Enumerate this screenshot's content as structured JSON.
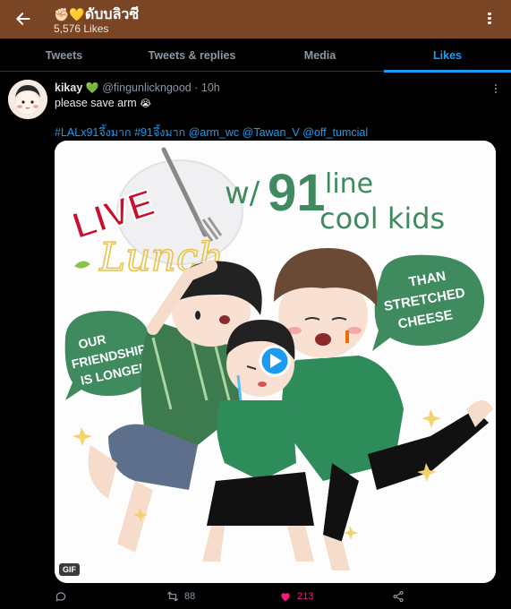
{
  "header": {
    "title_emoji": "✊🏻💛",
    "title": "ดับบลิวซี",
    "subtitle": "5,576 Likes"
  },
  "tabs": [
    {
      "label": "Tweets",
      "active": false
    },
    {
      "label": "Tweets & replies",
      "active": false
    },
    {
      "label": "Media",
      "active": false
    },
    {
      "label": "Likes",
      "active": true
    }
  ],
  "tweet": {
    "display_name": "kikay",
    "name_emoji": "💚",
    "handle": "@fingunlickngood",
    "time": "· 10h",
    "text": "please save arm",
    "text_emoji": "😭",
    "hashtags": [
      "#LALx91จึ้งมาก",
      "#91จึ้งมาก",
      "@arm_wc",
      "@Tawan_V",
      "@off_tumcial"
    ],
    "media": {
      "badge": "GIF",
      "art_text": {
        "live": "LIVE",
        "lunch": "Lunch",
        "with": "w/",
        "num": "91",
        "line1": "line",
        "line2": "cool kids",
        "left_bubble": [
          "OUR",
          "FRIENDSHIP",
          "IS LONGER"
        ],
        "right_bubble": [
          "THAN",
          "STRETCHED",
          "CHEESE"
        ]
      }
    },
    "actions": {
      "retweets": "88",
      "likes": "213"
    }
  },
  "colors": {
    "header_bg": "#7a4524",
    "accent": "#1d9bf0",
    "like": "#f91880",
    "art_green": "#3f8a5f"
  }
}
